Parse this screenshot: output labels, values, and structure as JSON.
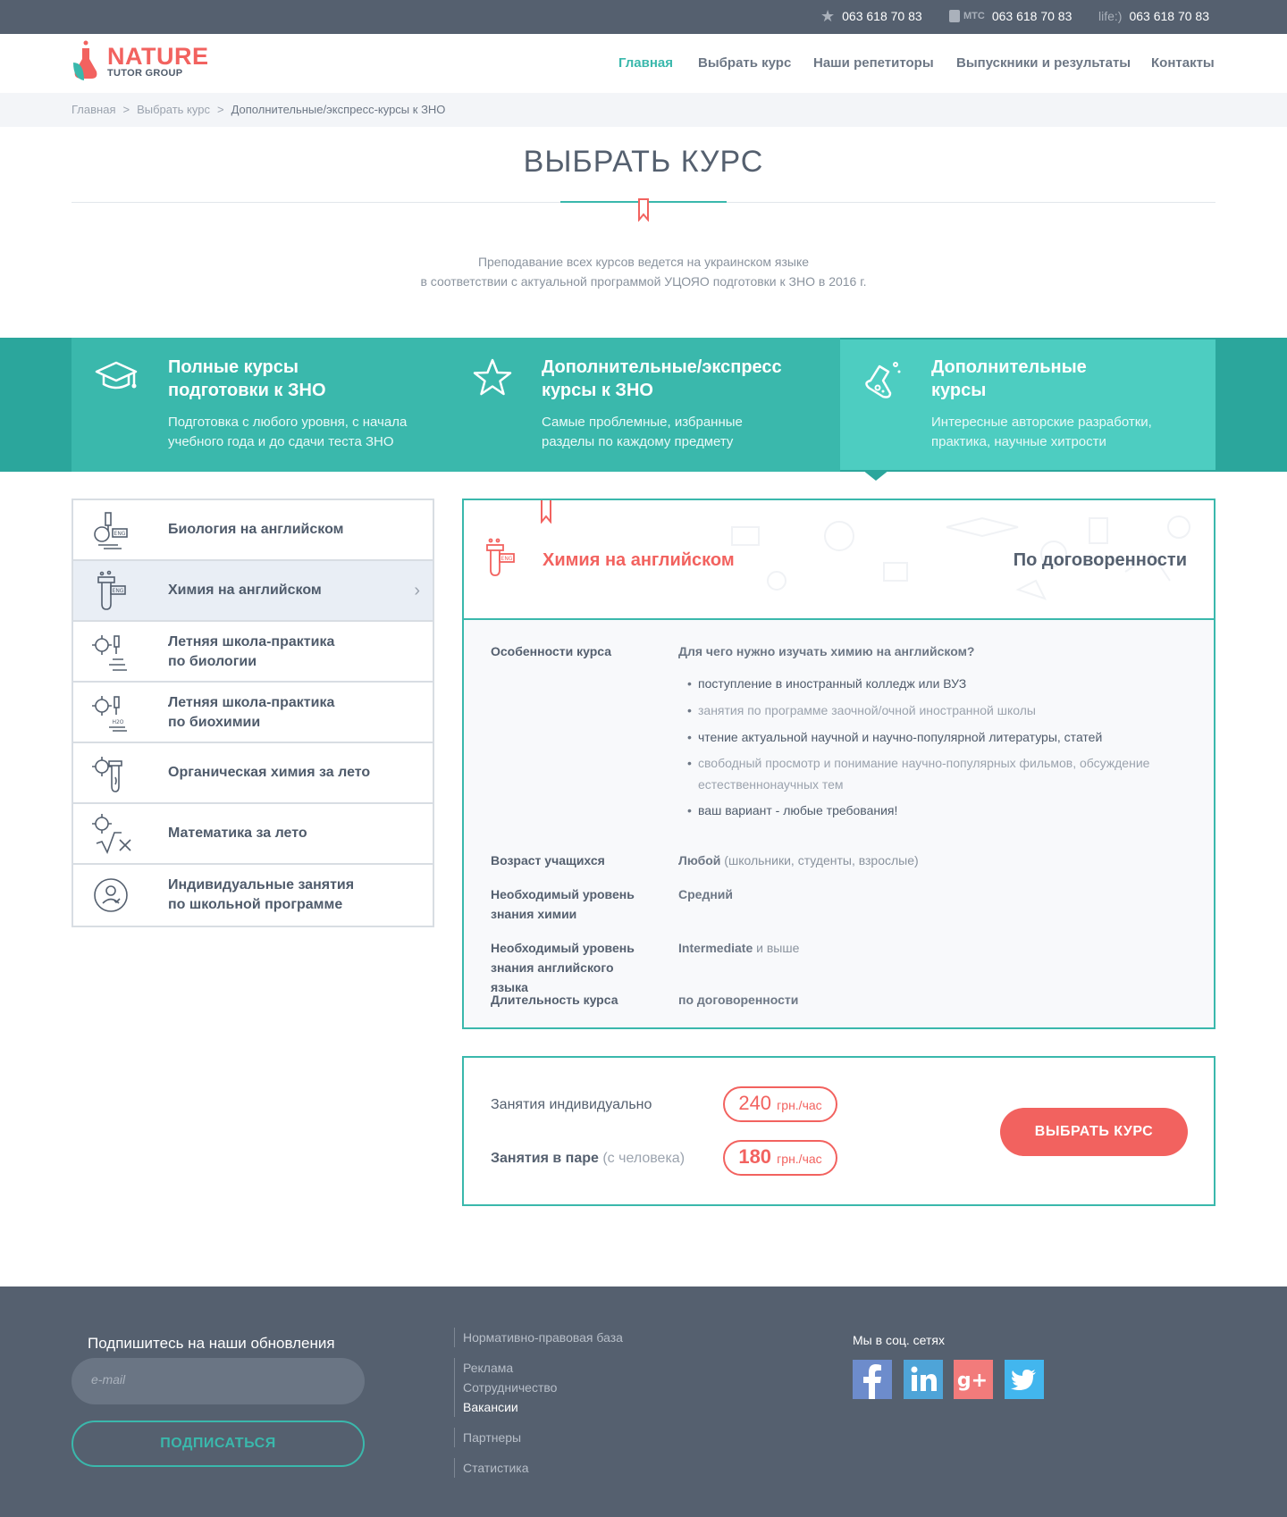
{
  "topbar": {
    "phones": [
      {
        "label": "★",
        "number": "063 618 70 83",
        "icon": "star-icon"
      },
      {
        "label": "МТС",
        "number": "063 618 70 83",
        "icon": "mts-icon"
      },
      {
        "label": "life:)",
        "number": "063 618 70 83",
        "icon": "life-icon"
      }
    ]
  },
  "logo": {
    "name": "NATURE",
    "sub": "TUTOR GROUP"
  },
  "nav": {
    "items": [
      "Главная",
      "Выбрать курс",
      "Наши репетиторы",
      "Выпускники и результаты",
      "Контакты"
    ],
    "active": "Главная"
  },
  "breadcrumbs": {
    "items": [
      "Главная",
      "Выбрать курс",
      "Дополнительные/экспресс-курсы к ЗНО"
    ],
    "separator": ">"
  },
  "page": {
    "title": "ВЫБРАТЬ КУРС",
    "intro1": "Преподавание всех курсов ведется на украинском языке",
    "intro2": "в соответствии с актуальной программой УЦОЯО подготовки к ЗНО в 2016 г."
  },
  "course_tabs": [
    {
      "title1": "Полные курсы",
      "title2": "подготовки к ЗНО",
      "desc1": "Подготовка с любого уровня, с начала",
      "desc2": "учебного года и до сдачи теста ЗНО",
      "icon": "graduation-cap-icon"
    },
    {
      "title1": "Дополнительные/экспресс",
      "title2": "курсы к ЗНО",
      "desc1": "Самые проблемные, избранные",
      "desc2": "разделы по каждому предмету",
      "icon": "star-icon"
    },
    {
      "title1": "Дополнительные",
      "title2": "курсы",
      "desc1": "Интересные авторские разработки,",
      "desc2": "практика, научные хитрости",
      "icon": "flask-icon"
    }
  ],
  "course_list": [
    {
      "l1": "Биология на английском",
      "l2": "",
      "icon": "microscope-eng-icon"
    },
    {
      "l1": "Химия на английском",
      "l2": "",
      "icon": "test-tube-eng-icon"
    },
    {
      "l1": "Летняя школа-практика",
      "l2": "по биологии",
      "icon": "summer-biology-icon"
    },
    {
      "l1": "Летняя школа-практика",
      "l2": "по биохимии",
      "icon": "summer-biochemistry-icon"
    },
    {
      "l1": "Органическая химия за лето",
      "l2": "",
      "icon": "organic-chemistry-icon"
    },
    {
      "l1": "Математика за лето",
      "l2": "",
      "icon": "math-icon"
    },
    {
      "l1": "Индивидуальные занятия",
      "l2": "по школьной программе",
      "icon": "individual-lessons-icon"
    }
  ],
  "course": {
    "title": "Химия на английском",
    "price": "По договоренности",
    "features_label": "Особенности курса",
    "features_q": "Для чего нужно изучать химию на английском?",
    "bullets": [
      "поступление в иностранный колледж или ВУЗ",
      "занятия по программе заочной/очной иностранной школы",
      "чтение актуальной научной и научно-популярной литературы, статей",
      "свободный просмотр и понимание научно-популярных фильмов, обсуждение",
      "естественнонаучных тем",
      "ваш вариант - любые требования!"
    ],
    "age_label": "Возраст учащихся",
    "age_value": "Любой",
    "age_note": "(школьники, студенты, взрослые)",
    "chem_label1": "Необходимый уровень",
    "chem_label2": "знания химии",
    "chem_value": "Средний",
    "eng_label1": "Необходимый уровень",
    "eng_label2": "знания английского языка",
    "eng_value": "Intermediate",
    "eng_note": "и выше",
    "dur_label": "Длительность курса",
    "dur_value": "по договоренности"
  },
  "pricing": {
    "individual_label": "Занятия индивидуально",
    "individual_price": "240",
    "pair_label": "Занятия в паре",
    "pair_note": "(с человека)",
    "pair_price": "180",
    "unit": "грн./час",
    "button": "ВЫБРАТЬ КУРС"
  },
  "footer": {
    "subscribe_title": "Подпишитесь на наши обновления",
    "email_placeholder": "e-mail",
    "subscribe_button": "ПОДПИСАТЬСЯ",
    "links": [
      [
        "Нормативно-правовая база"
      ],
      [
        "Реклама",
        "Сотрудничество",
        "Вакансии"
      ],
      [
        "Партнеры"
      ],
      [
        "Статистика"
      ]
    ],
    "social_title": "Мы в соц. сетях",
    "social": [
      {
        "icon": "facebook-icon",
        "color": "#6d8ccc"
      },
      {
        "icon": "linkedin-icon",
        "color": "#4ea4d8"
      },
      {
        "icon": "google-plus-icon",
        "color": "#f27b7b"
      },
      {
        "icon": "twitter-icon",
        "color": "#42b6ee"
      }
    ]
  },
  "colors": {
    "accent": "#3ab8ac",
    "brand": "#f2625f",
    "dark": "#55606f"
  }
}
